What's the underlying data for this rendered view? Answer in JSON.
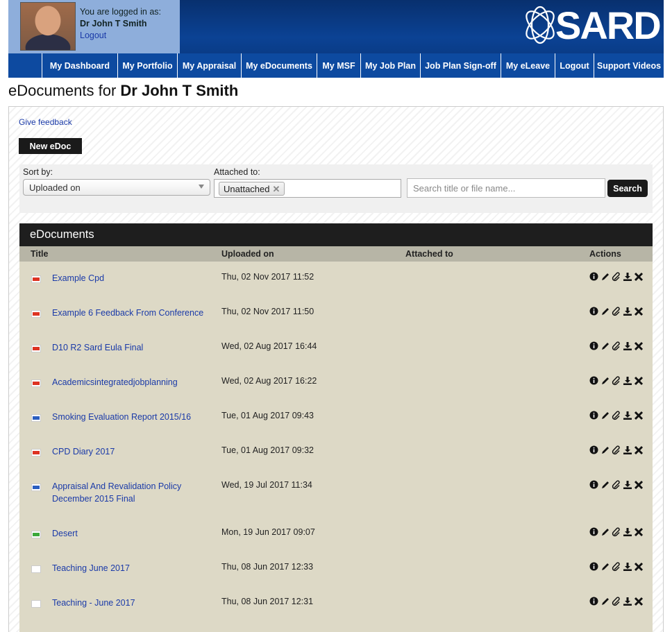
{
  "user": {
    "logged_in_label": "You are logged in as:",
    "name": "Dr John T Smith",
    "logout_label": "Logout"
  },
  "brand": {
    "logo_text": "SARD",
    "header_color": "#0b4294",
    "nav_color": "#0d4aa0"
  },
  "nav": {
    "items": [
      {
        "label": "My Dashboard"
      },
      {
        "label": "My Portfolio"
      },
      {
        "label": "My Appraisal"
      },
      {
        "label": "My eDocuments"
      },
      {
        "label": "My MSF"
      },
      {
        "label": "My Job Plan"
      },
      {
        "label": "Job Plan Sign-off"
      },
      {
        "label": "My eLeave"
      },
      {
        "label": "Logout"
      },
      {
        "label": "Support Videos"
      }
    ]
  },
  "page": {
    "title_prefix": "eDocuments for",
    "title_name": "Dr John T Smith",
    "feedback_label": "Give feedback",
    "new_button": "New eDoc"
  },
  "filters": {
    "sort_label": "Sort by:",
    "sort_value": "Uploaded on",
    "attached_label": "Attached to:",
    "attached_chip": "Unattached",
    "search_placeholder": "Search title or file name...",
    "search_button": "Search"
  },
  "table": {
    "title": "eDocuments",
    "columns": {
      "title": "Title",
      "uploaded": "Uploaded on",
      "attached": "Attached to",
      "actions": "Actions"
    },
    "rows": [
      {
        "type": "pdf",
        "title": "Example Cpd",
        "uploaded": "Thu, 02 Nov 2017 11:52",
        "attached": ""
      },
      {
        "type": "pdf",
        "title": "Example 6 Feedback From Conference",
        "uploaded": "Thu, 02 Nov 2017 11:50",
        "attached": ""
      },
      {
        "type": "pdf",
        "title": "D10 R2 Sard Eula Final",
        "uploaded": "Wed, 02 Aug 2017 16:44",
        "attached": ""
      },
      {
        "type": "pdf",
        "title": "Academicsintegratedjobplanning",
        "uploaded": "Wed, 02 Aug 2017 16:22",
        "attached": ""
      },
      {
        "type": "doc",
        "title": "Smoking Evaluation Report 2015/16",
        "uploaded": "Tue, 01 Aug 2017 09:43",
        "attached": ""
      },
      {
        "type": "pdf",
        "title": "CPD Diary 2017",
        "uploaded": "Tue, 01 Aug 2017 09:32",
        "attached": ""
      },
      {
        "type": "doc",
        "title": "Appraisal And Revalidation Policy December 2015 Final",
        "uploaded": "Wed, 19 Jul 2017 11:34",
        "attached": ""
      },
      {
        "type": "jpg",
        "title": "Desert",
        "uploaded": "Mon, 19 Jun 2017 09:07",
        "attached": ""
      },
      {
        "type": "blank",
        "title": "Teaching June 2017",
        "uploaded": "Thu, 08 Jun 2017 12:33",
        "attached": ""
      },
      {
        "type": "blank",
        "title": "Teaching - June 2017",
        "uploaded": "Thu, 08 Jun 2017 12:31",
        "attached": ""
      }
    ],
    "action_icons": [
      "info-icon",
      "pencil-icon",
      "paperclip-icon",
      "download-icon",
      "delete-icon"
    ]
  }
}
